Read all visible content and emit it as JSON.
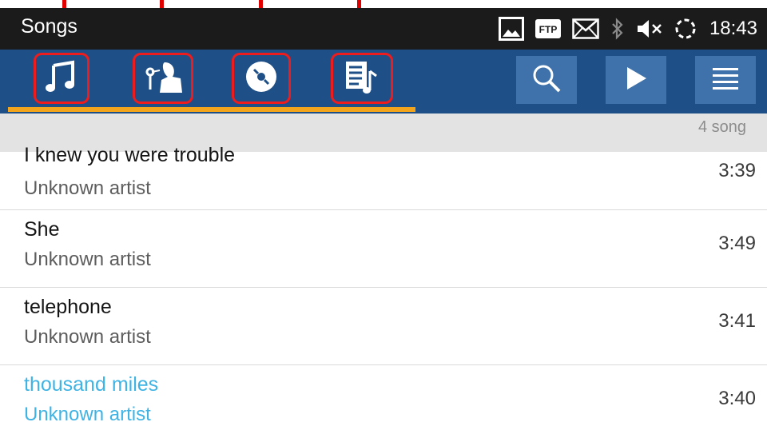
{
  "status_bar": {
    "title": "Songs",
    "time": "18:43",
    "icons": [
      "picture-icon",
      "ftp-icon",
      "mail-icon",
      "bluetooth-icon",
      "mute-icon",
      "sync-icon"
    ],
    "ftp_label": "FTP"
  },
  "tabs": [
    {
      "name": "songs",
      "icon": "music-note-icon",
      "selected": true
    },
    {
      "name": "artists",
      "icon": "artist-icon",
      "selected": false
    },
    {
      "name": "albums",
      "icon": "album-disc-icon",
      "selected": false
    },
    {
      "name": "playlists",
      "icon": "playlist-icon",
      "selected": false
    }
  ],
  "actions": [
    "search-icon",
    "play-icon",
    "menu-icon"
  ],
  "list_header": {
    "count_label": "4 song"
  },
  "songs": [
    {
      "title": "I knew you were trouble",
      "artist": "Unknown artist",
      "duration": "3:39",
      "active": false
    },
    {
      "title": "She",
      "artist": "Unknown artist",
      "duration": "3:49",
      "active": false
    },
    {
      "title": "telephone",
      "artist": "Unknown artist",
      "duration": "3:41",
      "active": false
    },
    {
      "title": "thousand miles",
      "artist": "Unknown artist",
      "duration": "3:40",
      "active": true
    }
  ],
  "colors": {
    "status_bg": "#1b1b1b",
    "tabbar_bg": "#1e4f86",
    "action_bg": "#3f72aa",
    "tab_indicator": "#f2a41c",
    "annotation_red": "#ee1c1c",
    "active_text": "#3fb3e4"
  }
}
